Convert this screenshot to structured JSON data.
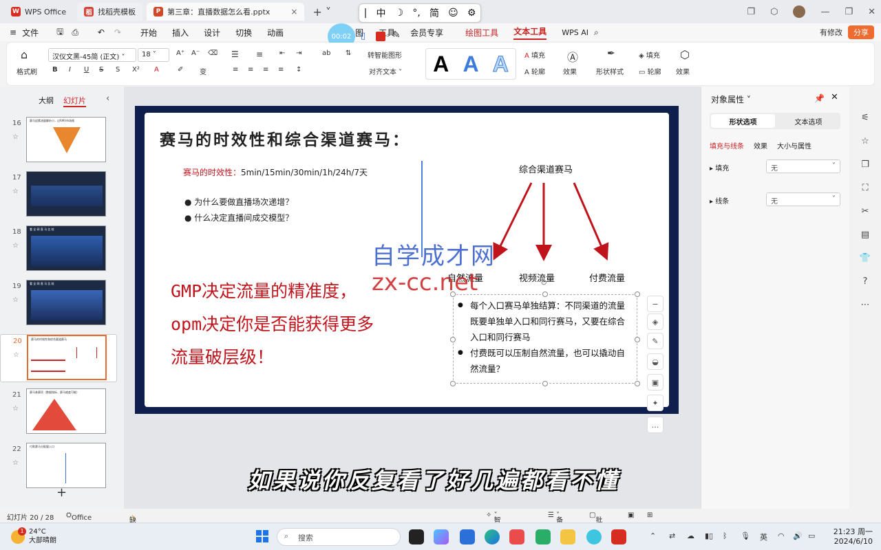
{
  "titlebar": {
    "tabs": [
      {
        "label": "WPS Office",
        "icon": "wps-logo-icon"
      },
      {
        "label": "找稻壳模板",
        "icon": "docer-icon"
      },
      {
        "label": "第三章：直播数据怎么看.pptx",
        "icon": "ppt-file-icon"
      }
    ],
    "ime": {
      "cursor": "|",
      "zh": "中",
      "moon": "☽",
      "punct": "°,",
      "simp": "简",
      "emoji": "☺",
      "gear": "⚙"
    }
  },
  "menubar": {
    "file": "文件",
    "items": [
      "开始",
      "插入",
      "设计",
      "切换",
      "动画",
      "图",
      "工具",
      "会员专享"
    ],
    "draw_tools": "绘图工具",
    "text_tools": "文本工具",
    "wps_ai": "WPS AI",
    "modify": "有修改",
    "share": "分享",
    "record_time": "00:02"
  },
  "ribbon": {
    "format_brush": "格式刷",
    "font_name": "汉仪文黑-45简 (正文)",
    "font_size": "18",
    "smart_shape": "转智能图形",
    "align_text": "对齐文本",
    "fill": "填充",
    "outline": "轮廓",
    "effect": "效果",
    "shape_style": "形状样式",
    "fill2": "填充",
    "outline2": "轮廓",
    "effect2": "效果"
  },
  "leftpanel": {
    "tab_outline": "大纲",
    "tab_slides": "幻灯片",
    "slides": [
      {
        "num": "16",
        "caption": "赛马因素流量解析小，过RMV市场格"
      },
      {
        "num": "17",
        "caption": ""
      },
      {
        "num": "18",
        "caption": "看 全 网 直 马 比 较"
      },
      {
        "num": "19",
        "caption": "看 全 网 直 马 比 较"
      },
      {
        "num": "20",
        "caption": "赛马的时效性和综合渠道赛马"
      },
      {
        "num": "21",
        "caption": "赛马参赛项（数据指标、赛马维度可能）"
      },
      {
        "num": "22",
        "caption": "付款赛马分配量入口"
      }
    ]
  },
  "slide": {
    "title": "赛马的时效性和综合渠道赛马：",
    "timing_label": "赛马的时效性：",
    "timing_value": "5min/15min/30min/1h/24h/7天",
    "bullets": [
      "为什么要做直播场次递增？",
      "什么决定直播间成交模型？"
    ],
    "channel_title": "综合渠道赛马",
    "channels": [
      "自然流量",
      "视频流量",
      "付费流量"
    ],
    "big_lines": [
      "GMP决定流量的精准度，",
      "opm决定你是否能获得更多",
      "流量破层级！"
    ],
    "box_bullets": [
      "每个入口赛马单独结算：不同渠道的流量既要单独单入口和同行赛马，又要在综合入口和同行赛马",
      "付费既可以压制自然流量，也可以撬动自然流量？"
    ],
    "watermark_cn": "自学成才网",
    "watermark_url": "zx-cc.net"
  },
  "subtitle": "如果说你反复看了好几遍都看不懂",
  "rightpanel": {
    "title": "对象属性",
    "tab_shape": "形状选项",
    "tab_text": "文本选项",
    "sub_fill_line": "填充与线条",
    "sub_effect": "效果",
    "sub_size": "大小与属性",
    "fill_label": "填充",
    "fill_value": "无",
    "line_label": "线条",
    "line_value": "无"
  },
  "statusbar": {
    "slide_count": "幻灯片 20 / 28",
    "theme": "Office 主题",
    "missing_font": "缺失字体",
    "smart_beautify": "智能美化",
    "notes": "备注",
    "comments": "批注"
  },
  "taskbar": {
    "temp": "24°C",
    "weather": "大部晴朗",
    "weather_badge": "1",
    "search": "搜索",
    "lang": "英",
    "time": "21:23 周一",
    "date": "2024/6/10"
  }
}
